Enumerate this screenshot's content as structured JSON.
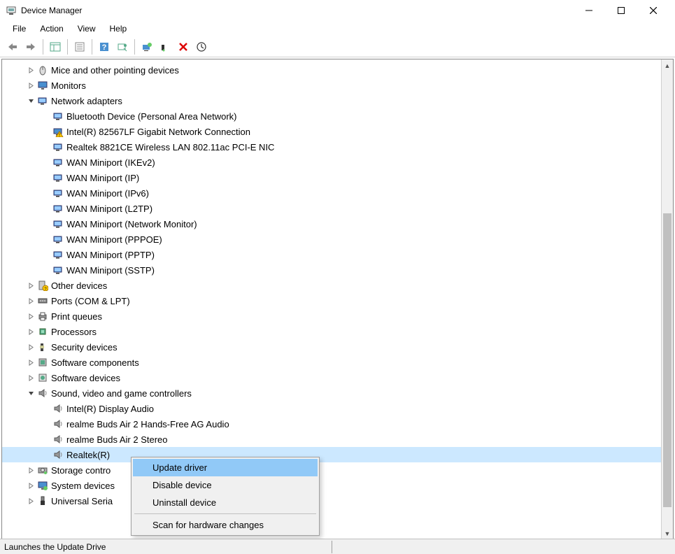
{
  "window": {
    "title": "Device Manager"
  },
  "menubar": {
    "items": [
      "File",
      "Action",
      "View",
      "Help"
    ]
  },
  "tree": {
    "nodes": [
      {
        "level": 1,
        "exp": ">",
        "icon": "mouse",
        "label": "Mice and other pointing devices"
      },
      {
        "level": 1,
        "exp": ">",
        "icon": "monitor",
        "label": "Monitors"
      },
      {
        "level": 1,
        "exp": "v",
        "icon": "net",
        "label": "Network adapters"
      },
      {
        "level": 2,
        "exp": "",
        "icon": "net",
        "label": "Bluetooth Device (Personal Area Network)"
      },
      {
        "level": 2,
        "exp": "",
        "icon": "net-warn",
        "label": "Intel(R) 82567LF Gigabit Network Connection"
      },
      {
        "level": 2,
        "exp": "",
        "icon": "net",
        "label": "Realtek 8821CE Wireless LAN 802.11ac PCI-E NIC"
      },
      {
        "level": 2,
        "exp": "",
        "icon": "net",
        "label": "WAN Miniport (IKEv2)"
      },
      {
        "level": 2,
        "exp": "",
        "icon": "net",
        "label": "WAN Miniport (IP)"
      },
      {
        "level": 2,
        "exp": "",
        "icon": "net",
        "label": "WAN Miniport (IPv6)"
      },
      {
        "level": 2,
        "exp": "",
        "icon": "net",
        "label": "WAN Miniport (L2TP)"
      },
      {
        "level": 2,
        "exp": "",
        "icon": "net",
        "label": "WAN Miniport (Network Monitor)"
      },
      {
        "level": 2,
        "exp": "",
        "icon": "net",
        "label": "WAN Miniport (PPPOE)"
      },
      {
        "level": 2,
        "exp": "",
        "icon": "net",
        "label": "WAN Miniport (PPTP)"
      },
      {
        "level": 2,
        "exp": "",
        "icon": "net",
        "label": "WAN Miniport (SSTP)"
      },
      {
        "level": 1,
        "exp": ">",
        "icon": "other",
        "label": "Other devices"
      },
      {
        "level": 1,
        "exp": ">",
        "icon": "port",
        "label": "Ports (COM & LPT)"
      },
      {
        "level": 1,
        "exp": ">",
        "icon": "printer",
        "label": "Print queues"
      },
      {
        "level": 1,
        "exp": ">",
        "icon": "cpu",
        "label": "Processors"
      },
      {
        "level": 1,
        "exp": ">",
        "icon": "security",
        "label": "Security devices"
      },
      {
        "level": 1,
        "exp": ">",
        "icon": "swc",
        "label": "Software components"
      },
      {
        "level": 1,
        "exp": ">",
        "icon": "swd",
        "label": "Software devices"
      },
      {
        "level": 1,
        "exp": "v",
        "icon": "sound",
        "label": "Sound, video and game controllers"
      },
      {
        "level": 2,
        "exp": "",
        "icon": "sound",
        "label": "Intel(R) Display Audio"
      },
      {
        "level": 2,
        "exp": "",
        "icon": "sound",
        "label": "realme Buds Air 2 Hands-Free AG Audio"
      },
      {
        "level": 2,
        "exp": "",
        "icon": "sound",
        "label": "realme Buds Air 2 Stereo"
      },
      {
        "level": 2,
        "exp": "",
        "icon": "sound",
        "label": "Realtek(R) ",
        "selected": true
      },
      {
        "level": 1,
        "exp": ">",
        "icon": "storage",
        "label": "Storage contro"
      },
      {
        "level": 1,
        "exp": ">",
        "icon": "system",
        "label": "System devices"
      },
      {
        "level": 1,
        "exp": ">",
        "icon": "usb",
        "label": "Universal Seria"
      }
    ]
  },
  "context_menu": {
    "items": [
      {
        "label": "Update driver",
        "highlighted": true
      },
      {
        "label": "Disable device"
      },
      {
        "label": "Uninstall device"
      },
      {
        "sep": true
      },
      {
        "label": "Scan for hardware changes"
      }
    ]
  },
  "statusbar": {
    "text": "Launches the Update Drive"
  }
}
